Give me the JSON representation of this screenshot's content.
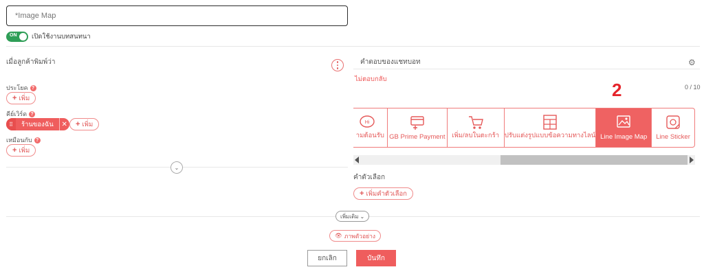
{
  "title_field": {
    "placeholder": "*Image Map"
  },
  "toggle": {
    "state_text": "ON",
    "label": "เปิดใช้งานบทสนทนา"
  },
  "left": {
    "heading": "เมื่อลูกค้าพิมพ์ว่า",
    "sentence_label": "ประโยค",
    "keyword_label": "คีย์เวิร์ด",
    "similar_label": "เหมือนกับ",
    "add_label": "เพิ่ม",
    "keyword_chip": "ร้านของฉัน",
    "help_glyph": "?"
  },
  "right": {
    "heading": "คำตอบของแชทบอท",
    "no_reply": "ไม่ตอบกลับ",
    "counter": "0 / 10",
    "step_number": "2",
    "tiles": [
      {
        "label": "ามต้อนรับ",
        "icon": "welcome-chat-icon"
      },
      {
        "label": "GB Prime Payment",
        "icon": "payment-card-icon"
      },
      {
        "label": "เพิ่ม/ลบในตะกร้า",
        "icon": "cart-icon"
      },
      {
        "label": "ปรับแต่งรูปแบบข้อความทางไลน์",
        "icon": "layout-grid-icon"
      },
      {
        "label": "Line Image Map",
        "icon": "image-map-icon",
        "active": true
      },
      {
        "label": "Line Sticker",
        "icon": "sticker-icon"
      }
    ],
    "options_label": "คำตัวเลือก",
    "add_option_label": "เพิ่มคำตัวเลือก"
  },
  "bottom": {
    "more_label": "เพิ่มเติม",
    "preview_label": "ภาพตัวอย่าง",
    "cancel_label": "ยกเลิก",
    "save_label": "บันทึก"
  },
  "colors": {
    "accent": "#ef5d5d",
    "toggle_on": "#2f9e57",
    "step_marker": "#e5242b"
  }
}
